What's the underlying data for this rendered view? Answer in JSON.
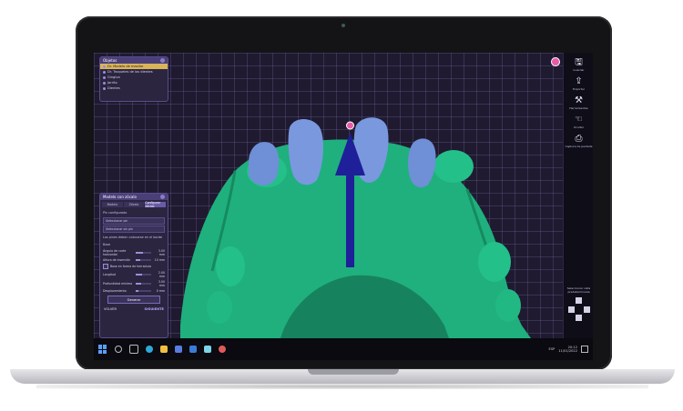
{
  "object_panel": {
    "title": "Objetos",
    "items": [
      {
        "label": "Dr. Modelo de maxilar",
        "active": true
      },
      {
        "label": "Dr. Troqueles de los dientes",
        "active": false
      },
      {
        "label": "Gingiva",
        "active": false
      },
      {
        "label": "Jarrito",
        "active": false
      },
      {
        "label": "Dientes",
        "active": false
      }
    ]
  },
  "settings_panel": {
    "title": "Modelo con zócalo",
    "tabs": [
      "Modelo",
      "Zócalo",
      "Configurar zócalo"
    ],
    "section_label": "Pin configurado",
    "field_1": "Seleccionar pin",
    "field_2": "Seleccionar sin pin",
    "note": "Los pines deben colocarse en el borde",
    "base_label": "Base",
    "sliders": [
      {
        "label": "Ángulo de corte horizontal",
        "value": "3.00 mm",
        "fill": 0.45
      },
      {
        "label": "Altura de inserción",
        "value": "10 mm",
        "fill": 0.3
      }
    ],
    "checkbox_label": "Base en forma de herradura",
    "sliders2": [
      {
        "label": "Longitud",
        "value": "2.00 mm",
        "fill": 0.4
      },
      {
        "label": "Profundidad mínima",
        "value": "3.00 mm",
        "fill": 0.35
      },
      {
        "label": "Desplazamiento",
        "value": "0 mm",
        "fill": 0.2
      }
    ],
    "apply_button": "Generar",
    "back_button": "VOLVER",
    "next_button": "SIGUIENTE"
  },
  "toolbar": {
    "items": [
      {
        "icon": "save-icon",
        "glyph": "🖫",
        "label": "Guardar"
      },
      {
        "icon": "export-icon",
        "glyph": "⇪",
        "label": "Exportar"
      },
      {
        "icon": "tools-icon",
        "glyph": "⚒",
        "label": "Herramientas"
      },
      {
        "icon": "hand-icon",
        "glyph": "☜",
        "label": "Ocultar"
      },
      {
        "icon": "screenshot-icon",
        "glyph": "⎙",
        "label": "Captura de pantalla"
      }
    ],
    "orientation_label": "Seleccionar vista predeterminada"
  },
  "taskbar": {
    "time": "20:12",
    "date": "11/01/2022",
    "lang": "ESP"
  },
  "colors": {
    "gingiva": "#1fb07e",
    "teeth": "#6f8fd6",
    "insertion_arrow": "#1f1f9a",
    "accent": "#6b5aa8"
  }
}
